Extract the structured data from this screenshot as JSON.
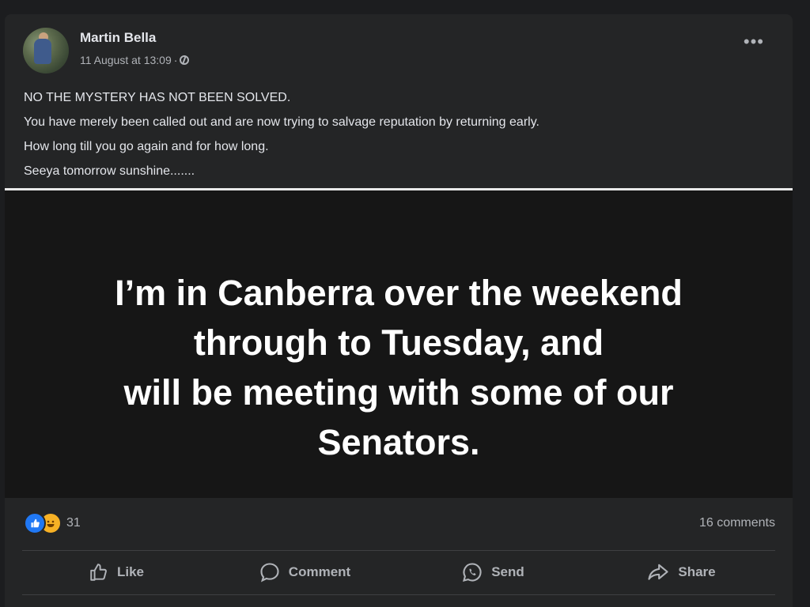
{
  "post": {
    "author": "Martin Bella",
    "date": "11 August at 13:09",
    "separator": "·",
    "caption": [
      "NO THE MYSTERY HAS NOT BEEN SOLVED.",
      "You have merely been called out and are now trying to salvage reputation by returning early.",
      "How long till you go again and for how long.",
      "Seeya tomorrow sunshine......."
    ],
    "image_text": [
      "I’m in Canberra over the weekend",
      "through to Tuesday, and",
      "will be meeting with some of our",
      "Senators."
    ],
    "reaction_count": "31",
    "comments_count": "16 comments",
    "actions": {
      "like": "Like",
      "comment": "Comment",
      "send": "Send",
      "share": "Share"
    }
  },
  "icons": [
    "more-icon",
    "globe-icon",
    "like-reaction-icon",
    "haha-reaction-icon",
    "thumbs-up-icon",
    "comment-bubble-icon",
    "whatsapp-send-icon",
    "share-arrow-icon"
  ],
  "colors": {
    "background": "#1c1d1f",
    "card": "#242526",
    "text_primary": "#e4e6eb",
    "text_secondary": "#b0b3b8",
    "like_blue": "#2078f4",
    "haha_yellow": "#f7b125"
  }
}
